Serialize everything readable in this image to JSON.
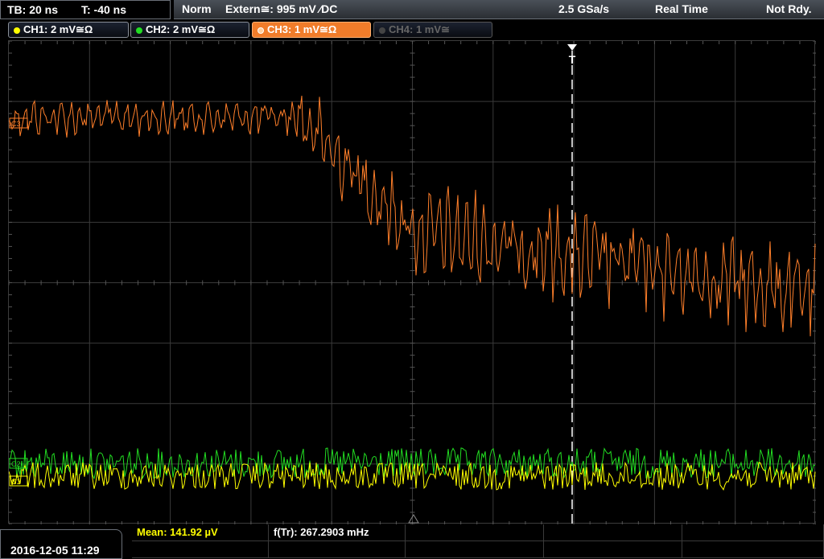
{
  "top": {
    "timebase": "TB: 20 ns",
    "trigger_time": "T: -40 ns",
    "trigger_mode": "Norm",
    "trigger_source": "Extern≅: 995 mV ⁄DC",
    "sample_rate": "2.5 GSa/s",
    "acq_mode": "Real Time",
    "status": "Not Rdy."
  },
  "channels": [
    {
      "label": "CH1: 2 mV≅Ω",
      "color": "#ffff00"
    },
    {
      "label": "CH2: 2 mV≅Ω",
      "color": "#22dd22"
    },
    {
      "label": "CH3: 1 mV≅Ω",
      "color": "#ff7f2a"
    },
    {
      "label": "CH4: 1 mV≅",
      "color": "#666666"
    }
  ],
  "markers": {
    "trigger": "T",
    "ch3": "C3",
    "ch2": "C2",
    "ch1": "C1"
  },
  "bottom": {
    "datetime": "2016-12-05 11:29",
    "mean": "Mean: 141.92 µV",
    "freq": "f(Tr): 267.2903 mHz"
  },
  "colors": {
    "ch1": "#ffff00",
    "ch2": "#22dd22",
    "ch3": "#ff7f2a",
    "grid": "#3c3c3c",
    "mean_text": "#ffff00"
  }
}
